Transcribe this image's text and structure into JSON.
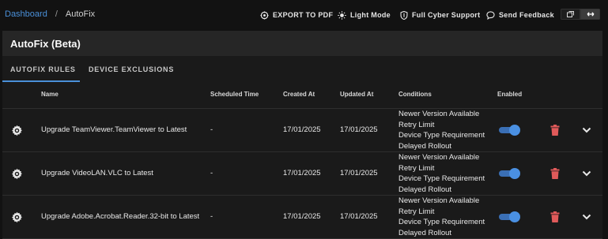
{
  "breadcrumb": {
    "root": "Dashboard",
    "separator": "/",
    "current": "AutoFix"
  },
  "toolbar": {
    "export_label": "EXPORT TO PDF",
    "light_mode_label": "Light Mode",
    "support_label": "Full Cyber Support",
    "feedback_label": "Send Feedback"
  },
  "panel": {
    "title": "AutoFix (Beta)"
  },
  "tabs": [
    {
      "label": "AUTOFIX RULES",
      "active": true
    },
    {
      "label": "DEVICE EXCLUSIONS",
      "active": false
    }
  ],
  "table": {
    "headers": {
      "name": "Name",
      "scheduled": "Scheduled Time",
      "created": "Created At",
      "updated": "Updated At",
      "conditions": "Conditions",
      "enabled": "Enabled"
    },
    "rows": [
      {
        "name": "Upgrade TeamViewer.TeamViewer to Latest",
        "scheduled": "-",
        "created": "17/01/2025",
        "updated": "17/01/2025",
        "conditions": [
          "Newer Version Available",
          "Retry Limit",
          "Device Type Requirement",
          "Delayed Rollout"
        ],
        "enabled": true
      },
      {
        "name": "Upgrade VideoLAN.VLC to Latest",
        "scheduled": "-",
        "created": "17/01/2025",
        "updated": "17/01/2025",
        "conditions": [
          "Newer Version Available",
          "Retry Limit",
          "Device Type Requirement",
          "Delayed Rollout"
        ],
        "enabled": true
      },
      {
        "name": "Upgrade Adobe.Acrobat.Reader.32-bit to Latest",
        "scheduled": "-",
        "created": "17/01/2025",
        "updated": "17/01/2025",
        "conditions": [
          "Newer Version Available",
          "Retry Limit",
          "Device Type Requirement",
          "Delayed Rollout"
        ],
        "enabled": true
      }
    ]
  },
  "colors": {
    "accent": "#4a90d9",
    "toggle_on": "#4a90e2",
    "delete": "#e05a5a",
    "background": "#121212"
  }
}
